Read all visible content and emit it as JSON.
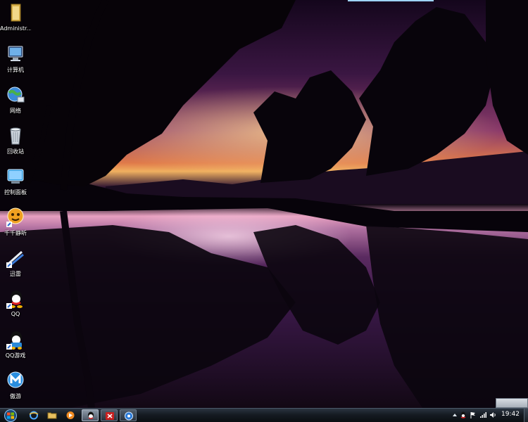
{
  "desktop": {
    "icons": [
      {
        "label": "Administr...",
        "icon": "folder-icon"
      },
      {
        "label": "计算机",
        "icon": "computer-icon"
      },
      {
        "label": "网络",
        "icon": "network-icon"
      },
      {
        "label": "回收站",
        "icon": "recycle-bin-icon"
      },
      {
        "label": "控制面板",
        "icon": "control-panel-icon"
      },
      {
        "label": "千千静听",
        "icon": "ttplayer-icon"
      },
      {
        "label": "迅雷",
        "icon": "thunder-icon"
      },
      {
        "label": "QQ",
        "icon": "qq-icon"
      },
      {
        "label": "QQ游戏",
        "icon": "qq-game-icon"
      },
      {
        "label": "傲游",
        "icon": "maxthon-icon"
      }
    ]
  },
  "taskbar": {
    "start_icon": "windows-start-icon",
    "pinned": [
      {
        "name": "internet-explorer",
        "icon": "ie-icon"
      },
      {
        "name": "explorer",
        "icon": "folder-icon"
      },
      {
        "name": "media-player",
        "icon": "media-player-icon"
      },
      {
        "name": "qq",
        "icon": "qq-icon",
        "state": "active"
      },
      {
        "name": "app-red",
        "icon": "red-app-icon",
        "state": "open"
      },
      {
        "name": "app-blue",
        "icon": "blue-app-icon",
        "state": "open"
      }
    ],
    "clock": "19:42"
  },
  "colors": {
    "taskbar": "#151b22",
    "accent": "#9fd3ff",
    "sky_glow": "#e07b4a"
  }
}
